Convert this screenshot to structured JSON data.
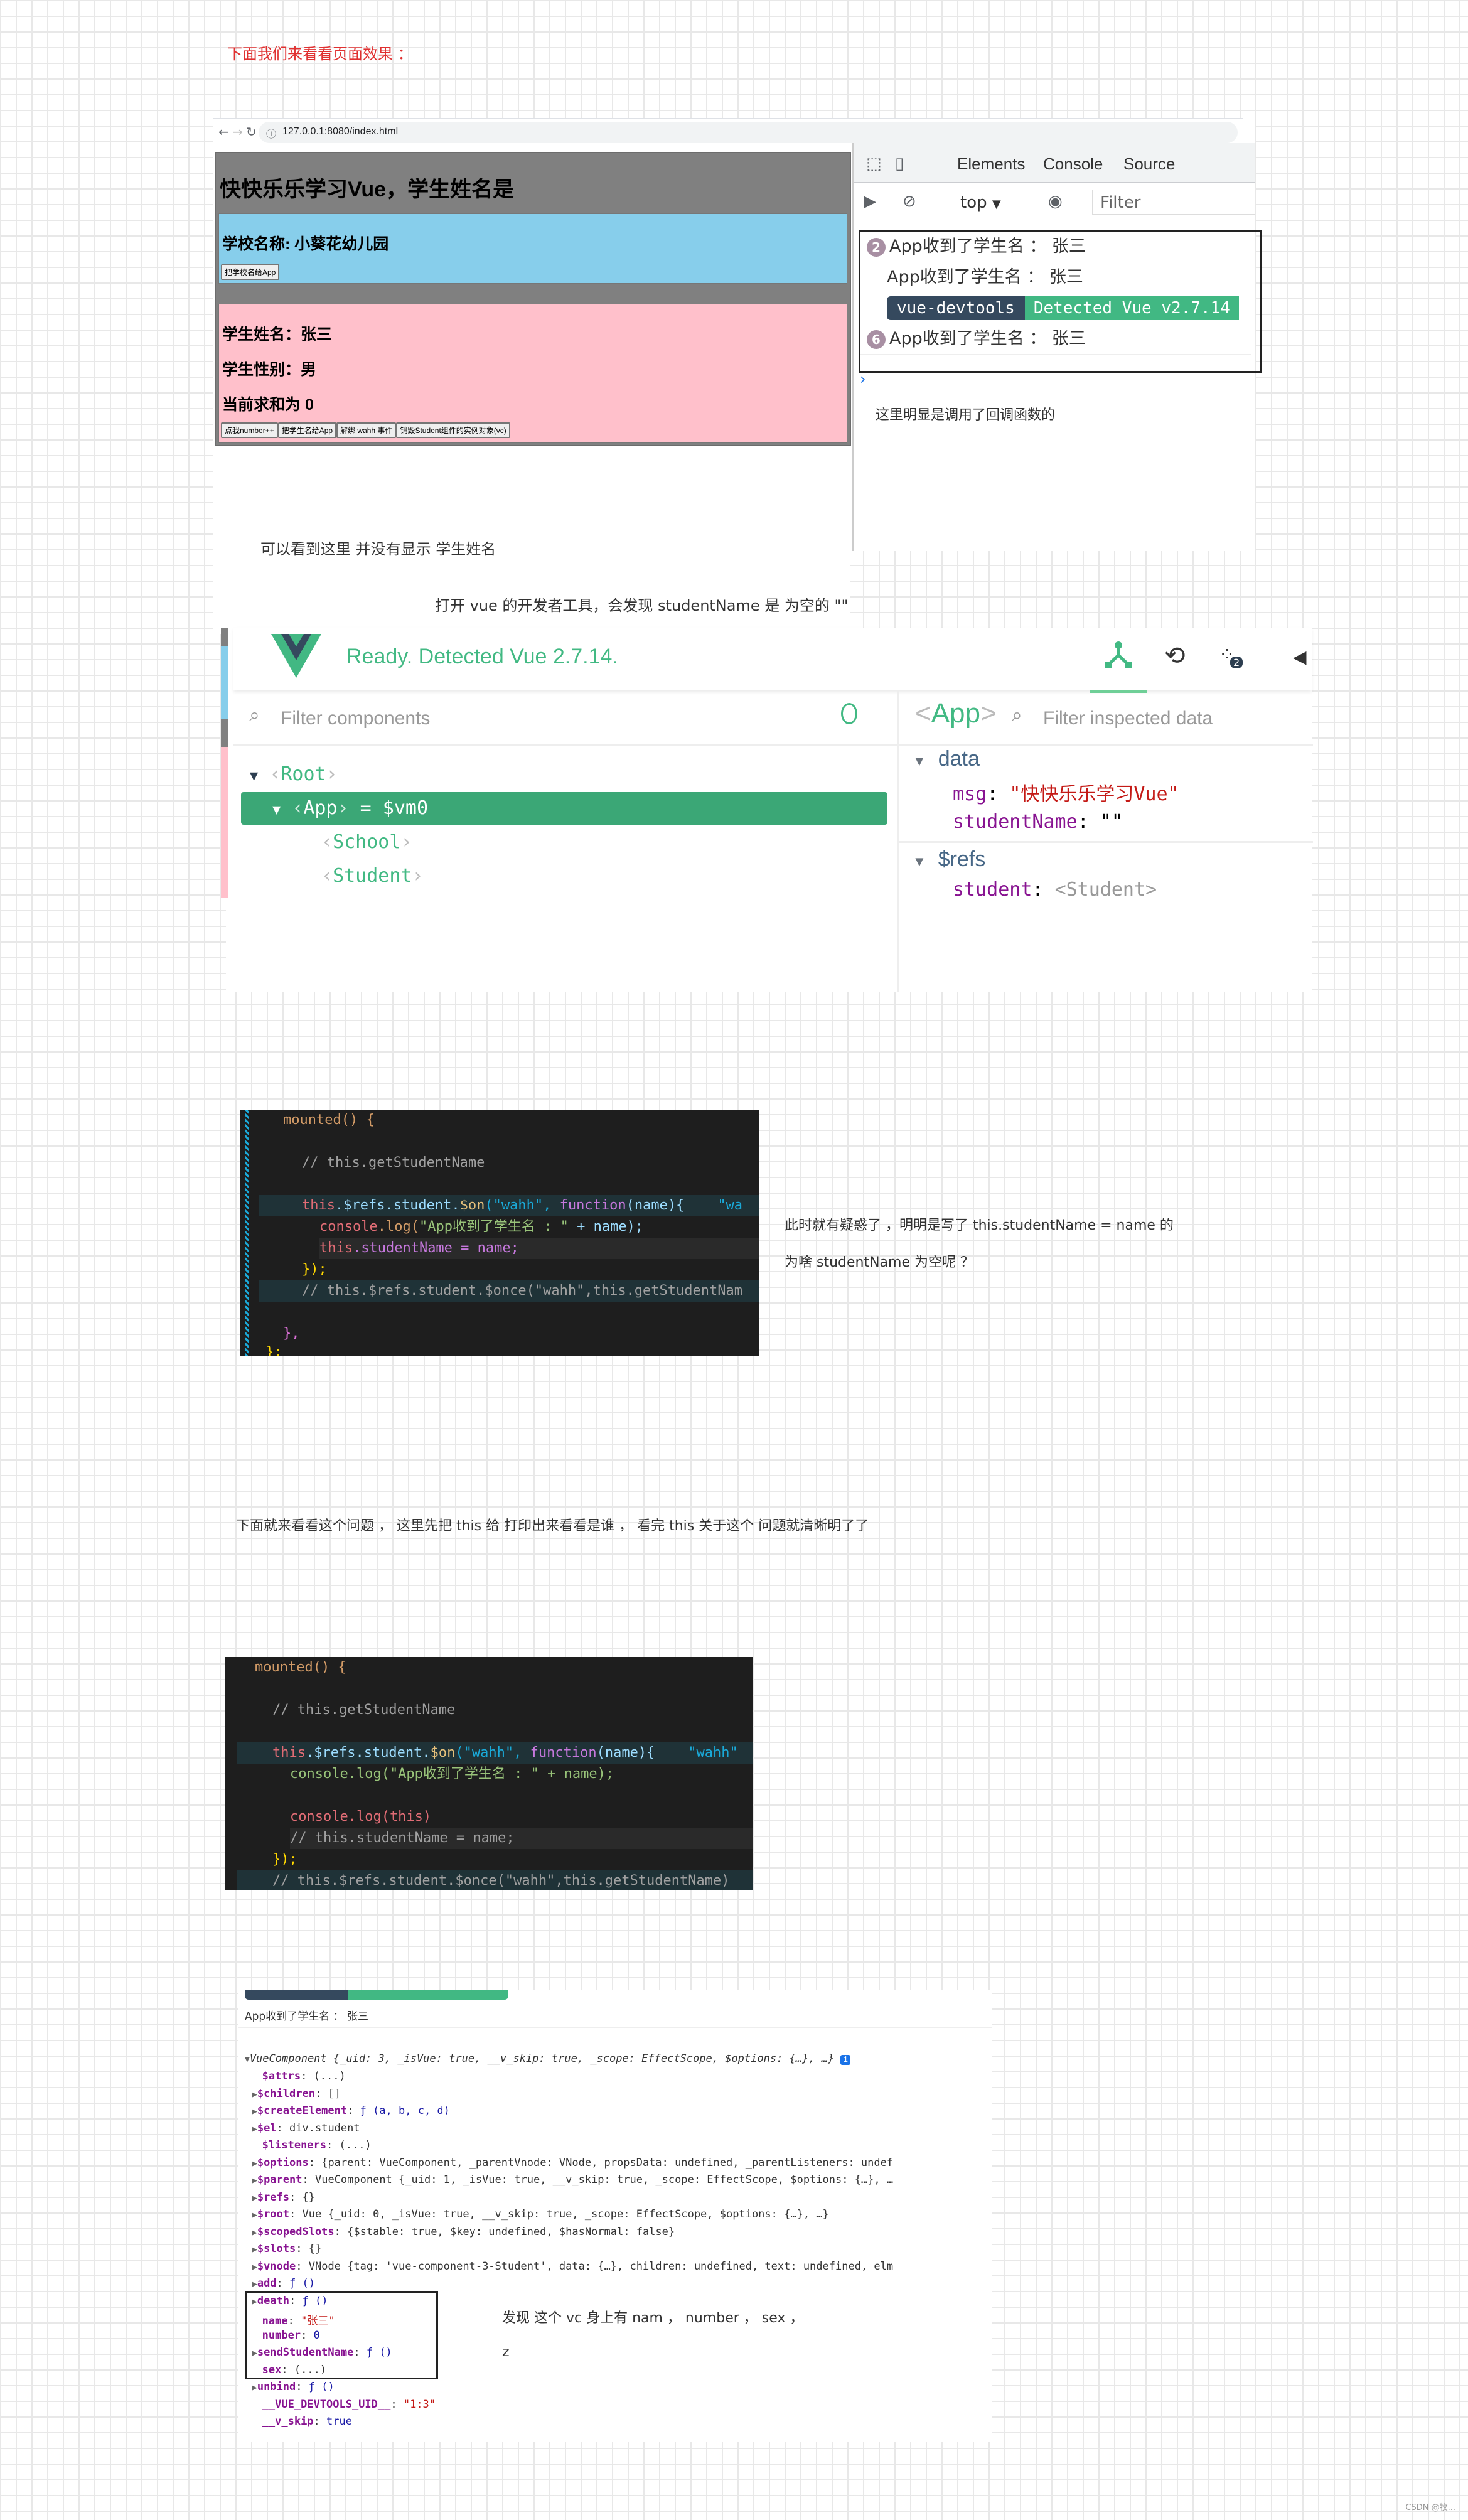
{
  "intro_note": "下面我们来看看页面效果 ：",
  "browser": {
    "url": "127.0.0.1:8080/index.html",
    "app_title": "快快乐乐学习Vue，学生姓名是",
    "school": {
      "label": "学校名称: 小葵花幼儿园",
      "button": "把学校名给App"
    },
    "student": {
      "name_line": "学生姓名：张三",
      "sex_line": "学生性别：男",
      "sum_line": "当前求和为 0",
      "buttons": [
        "点我number++",
        "把学生名给App",
        "解绑 wahh 事件",
        "销毁Student组件的实例对象(vc)"
      ]
    },
    "page_note": "可以看到这里  并没有显示  学生姓名"
  },
  "devtools": {
    "tabs": [
      "Elements",
      "Console",
      "Source"
    ],
    "active_tab": "Console",
    "context": "top",
    "filter_placeholder": "Filter",
    "console_rows": [
      {
        "count": "2",
        "text": "App收到了学生名 ： 张三"
      },
      {
        "count": "",
        "text": "App收到了学生名 ： 张三"
      },
      {
        "count": "6",
        "text": "App收到了学生名 ： 张三"
      }
    ],
    "vue_badge": {
      "left": "vue-devtools",
      "right": "Detected Vue v2.7.14"
    },
    "note": "这里明显是调用了回调函数的"
  },
  "note_open_devtools": "打开 vue 的开发者工具，会发现 studentName 是 为空的 \"\"",
  "vue_devtools": {
    "status": "Ready. Detected Vue 2.7.14.",
    "filter_components_placeholder": "Filter components",
    "tree": [
      {
        "name": "Root",
        "suffix": "",
        "selected": false
      },
      {
        "name": "App",
        "suffix": " = $vm0",
        "selected": true
      },
      {
        "name": "School",
        "suffix": "",
        "selected": false
      },
      {
        "name": "Student",
        "suffix": "",
        "selected": false
      }
    ],
    "inspected": "App",
    "filter_data_placeholder": "Filter inspected data",
    "sections": {
      "data_title": "data",
      "msg_key": "msg",
      "msg_value": "\"快快乐乐学习Vue\"",
      "studentName_key": "studentName",
      "studentName_value": "\"\"",
      "refs_title": "$refs",
      "student_key": "student",
      "student_value": "<Student>"
    },
    "perf_badge": "2"
  },
  "code1": {
    "l1": "mounted() {",
    "l2": "// this.getStudentName",
    "l3a": "this",
    "l3b": ".$refs.student.",
    "l3c": "$on",
    "l3d": "(\"wahh\", ",
    "l3e": "function",
    "l3f": "(name){",
    "l3g": "\"wa",
    "l4a": "console",
    "l4b": ".log(",
    "l4c": "\"App收到了学生名 : \"",
    "l4d": " + name);",
    "l5a": "this",
    "l5b": ".studentName = name;",
    "l6": "});",
    "l7": "// this.$refs.student.$once(\"wahh\",this.getStudentNam",
    "l8": "},",
    "l9": "};"
  },
  "question_note": {
    "line1": "此时就有疑惑了 ，明明是写了 this.studentName = name 的",
    "line2": "为啥 studentName 为空呢 ？"
  },
  "this_note": "下面就来看看这个问题 ，  这里先把 this 给 打印出来看看是谁 ，  看完 this 关于这个 问题就清晰明了了",
  "code2": {
    "l1": "mounted() {",
    "l2": "// this.getStudentName",
    "l3g": "\"wahh\"",
    "l4": "console.log(\"App收到了学生名 : \" + name);",
    "l5": "console.log(this)",
    "l6": "// this.studentName = name;",
    "l7": "});",
    "l8": "// this.$refs.student.$once(\"wahh\",this.getStudentName)"
  },
  "dump": {
    "top_log": "App收到了学生名 ： 张三",
    "header": "VueComponent {_uid: 3, _isVue: true, __v_skip: true, _scope: EffectScope, $options: {…}, …}",
    "rows": [
      {
        "arrow": false,
        "key": "$attrs",
        "val": "(...)"
      },
      {
        "arrow": true,
        "key": "$children",
        "val": "[]"
      },
      {
        "arrow": true,
        "key": "$createElement",
        "val": "ƒ (a, b, c, d)"
      },
      {
        "arrow": true,
        "key": "$el",
        "val": "div.student"
      },
      {
        "arrow": false,
        "key": "$listeners",
        "val": "(...)"
      },
      {
        "arrow": true,
        "key": "$options",
        "val": "{parent: VueComponent, _parentVnode: VNode, propsData: undefined, _parentListeners: undef"
      },
      {
        "arrow": true,
        "key": "$parent",
        "val": "VueComponent {_uid: 1, _isVue: true, __v_skip: true, _scope: EffectScope, $options: {…}, …"
      },
      {
        "arrow": true,
        "key": "$refs",
        "val": "{}"
      },
      {
        "arrow": true,
        "key": "$root",
        "val": "Vue {_uid: 0, _isVue: true, __v_skip: true, _scope: EffectScope, $options: {…}, …}"
      },
      {
        "arrow": true,
        "key": "$scopedSlots",
        "val": "{$stable: true, $key: undefined, $hasNormal: false}"
      },
      {
        "arrow": true,
        "key": "$slots",
        "val": "{}"
      },
      {
        "arrow": true,
        "key": "$vnode",
        "val": "VNode {tag: 'vue-component-3-Student', data: {…}, children: undefined, text: undefined, elm"
      },
      {
        "arrow": true,
        "key": "add",
        "val": "ƒ ()"
      },
      {
        "arrow": true,
        "key": "death",
        "val": "ƒ ()"
      },
      {
        "arrow": false,
        "key": "name",
        "val": "\"张三\""
      },
      {
        "arrow": false,
        "key": "number",
        "val": "0"
      },
      {
        "arrow": true,
        "key": "sendStudentName",
        "val": "ƒ ()"
      },
      {
        "arrow": false,
        "key": "sex",
        "val": "(...)"
      },
      {
        "arrow": true,
        "key": "unbind",
        "val": "ƒ ()"
      },
      {
        "arrow": false,
        "key": "__VUE_DEVTOOLS_UID__",
        "val": "\"1:3\""
      },
      {
        "arrow": false,
        "key": "__v_skip",
        "val": "true"
      }
    ],
    "note_line1": "发现 这个 vc 身上有 nam ， number ， sex ，",
    "note_line2": "z"
  },
  "watermark": "CSDN @牧..."
}
